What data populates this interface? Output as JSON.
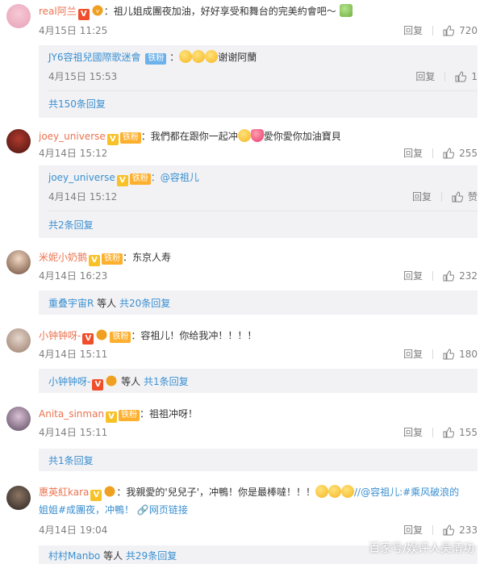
{
  "comments": [
    {
      "user": "real阿兰",
      "text": "：祖儿姐成團夜加油，好好享受和舞台的完美約會吧～",
      "time": "4月15日 11:25",
      "reply_label": "回复",
      "likes": "720",
      "sub": {
        "user": "JY6容祖兒國際歌迷會",
        "fan_badge": "铁粉",
        "text": "谢谢阿蘭",
        "time": "4月15日 15:53",
        "reply_label": "回复",
        "likes": "1"
      },
      "more": "共150条回复"
    },
    {
      "user": "joey_universe",
      "fan_badge": "铁粉",
      "text": "：我們都在跟你一起冲",
      "text2": "愛你愛你加油寶貝",
      "time": "4月14日 15:12",
      "reply_label": "回复",
      "likes": "255",
      "sub": {
        "user": "joey_universe",
        "fan_badge": "铁粉",
        "text": "：@容祖儿",
        "time": "4月14日 15:12",
        "reply_label": "回复",
        "likes": "赞"
      },
      "more": "共2条回复"
    },
    {
      "user": "米妮小奶鹅",
      "fan_badge": "铁粉",
      "text": "：东京人寿",
      "time": "4月14日 16:23",
      "reply_label": "回复",
      "likes": "232",
      "more_user": "重叠宇宙R",
      "more_mid": " 等人 ",
      "more": "共20条回复"
    },
    {
      "user": "小钟钟呀-",
      "fan_badge": "铁粉",
      "text": "：容祖儿！你给我冲！！！！",
      "time": "4月14日 15:11",
      "reply_label": "回复",
      "likes": "180",
      "more_user": "小钟钟呀-",
      "more_mid": " 等人 ",
      "more": "共1条回复"
    },
    {
      "user": "Anita_sinman",
      "fan_badge": "铁粉",
      "text": "：祖祖冲呀！",
      "time": "4月14日 15:11",
      "reply_label": "回复",
      "likes": "155",
      "more": "共1条回复"
    },
    {
      "user": "惠英紅kara",
      "text": "：我親愛的'兒兒子'，冲鴨！你是最棒噠！！！",
      "mention": "//@容祖儿:#乘风破浪的",
      "text_line2": "姐姐#成團夜，冲鴨！",
      "web_link": "网页链接",
      "time": "4月14日 19:04",
      "reply_label": "回复",
      "likes": "233",
      "more_user": "村村Manbo",
      "more_mid": " 等人 ",
      "more": "共29条回复"
    }
  ],
  "watermark": "百家号/娱评人吴清功",
  "colors": {
    "name": "#eb7350",
    "link": "#3a8fd0",
    "meta": "#808080",
    "sub_bg": "#f2f2f5"
  }
}
